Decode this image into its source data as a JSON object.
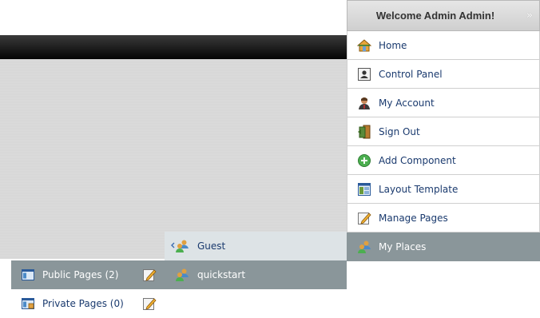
{
  "dock": {
    "title": "Welcome Admin Admin!",
    "items": [
      {
        "label": "Home",
        "icon": "home-icon"
      },
      {
        "label": "Control Panel",
        "icon": "control-panel-icon"
      },
      {
        "label": "My Account",
        "icon": "user-icon"
      },
      {
        "label": "Sign Out",
        "icon": "door-exit-icon"
      },
      {
        "label": "Add Component",
        "icon": "plus-circle-icon"
      },
      {
        "label": "Layout Template",
        "icon": "layout-icon"
      },
      {
        "label": "Manage Pages",
        "icon": "edit-icon"
      },
      {
        "label": "My Places",
        "icon": "group-icon"
      }
    ]
  },
  "places": [
    {
      "label": "Guest",
      "icon": "group-back-icon"
    },
    {
      "label": "quickstart",
      "icon": "group-icon"
    }
  ],
  "pages": {
    "public_label": "Public Pages (2)",
    "private_label": "Private Pages (0)"
  },
  "colors": {
    "active_bg": "#8a969a",
    "link": "#1a3a6e",
    "hover_bg": "#dde3e6"
  }
}
